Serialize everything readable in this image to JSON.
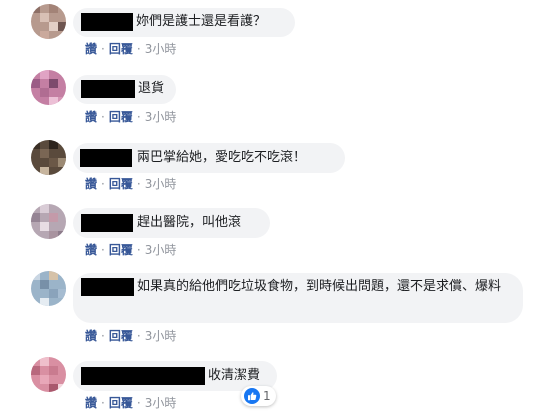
{
  "comments": [
    {
      "text": "妳們是護士還是看護？",
      "actions": {
        "like": "讚",
        "reply": "回覆",
        "sep": "·",
        "time": "3小時"
      }
    },
    {
      "text": "退貨",
      "actions": {
        "like": "讚",
        "reply": "回覆",
        "sep": "·",
        "time": "3小時"
      }
    },
    {
      "text": "兩巴掌給她，愛吃吃不吃滾！",
      "actions": {
        "like": "讚",
        "reply": "回覆",
        "sep": "·",
        "time": "3小時"
      }
    },
    {
      "text": "趕出醫院，叫他滾",
      "actions": {
        "like": "讚",
        "reply": "回覆",
        "sep": "·",
        "time": "3小時"
      }
    },
    {
      "text": "如果真的給他們吃垃圾食物，到時候出問題，還不是求償、爆料",
      "actions": {
        "like": "讚",
        "reply": "回覆",
        "sep": "·",
        "time": "3小時"
      }
    },
    {
      "text": "收清潔費",
      "actions": {
        "like": "讚",
        "reply": "回覆",
        "sep": "·",
        "time": "3小時"
      },
      "reaction_count": "1"
    }
  ],
  "colors": {
    "link": "#385898",
    "bubble": "#f2f3f5",
    "like_blue": "#1877f2"
  }
}
